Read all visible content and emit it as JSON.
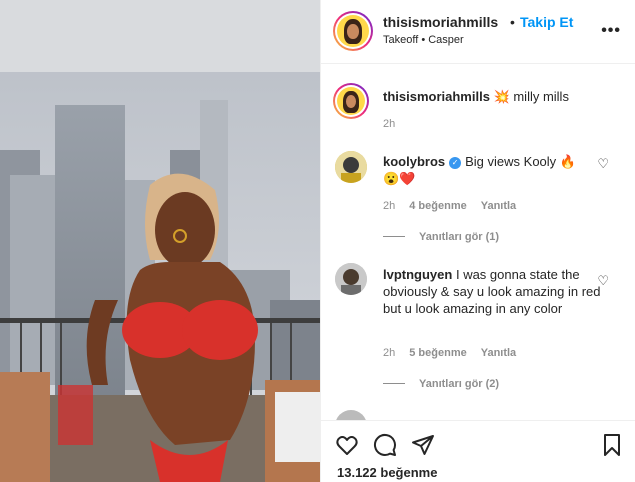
{
  "post": {
    "username": "thisismoriahmills",
    "dot": "•",
    "follow_label": "Takip Et",
    "audio": "Takeoff • Casper",
    "more": "•••"
  },
  "caption": {
    "username": "thisismoriahmills",
    "emoji": "💥",
    "text": " milly mills",
    "time": "2h"
  },
  "comments": [
    {
      "username": "koolybros",
      "verified_mark": "✓",
      "text": "Big views Kooly 🔥",
      "text2": "😮❤️",
      "time": "2h",
      "likes": "4 beğenme",
      "reply": "Yanıtla",
      "view_replies": "Yanıtları gör (1)"
    },
    {
      "username": "lvptnguyen",
      "text": "I was gonna state the obviously & say u look amazing in red but u look amazing in any color",
      "time": "2h",
      "likes": "5 beğenme",
      "reply": "Yanıtla",
      "view_replies": "Yanıtları gör (2)"
    }
  ],
  "likes_total": "13.122 beğenme",
  "icons": {
    "like": "heart-icon",
    "comment": "comment-icon",
    "share": "share-icon",
    "save": "bookmark-icon"
  },
  "colors": {
    "accent": "#0095f6",
    "text": "#262626",
    "muted": "#8e8e8e"
  }
}
